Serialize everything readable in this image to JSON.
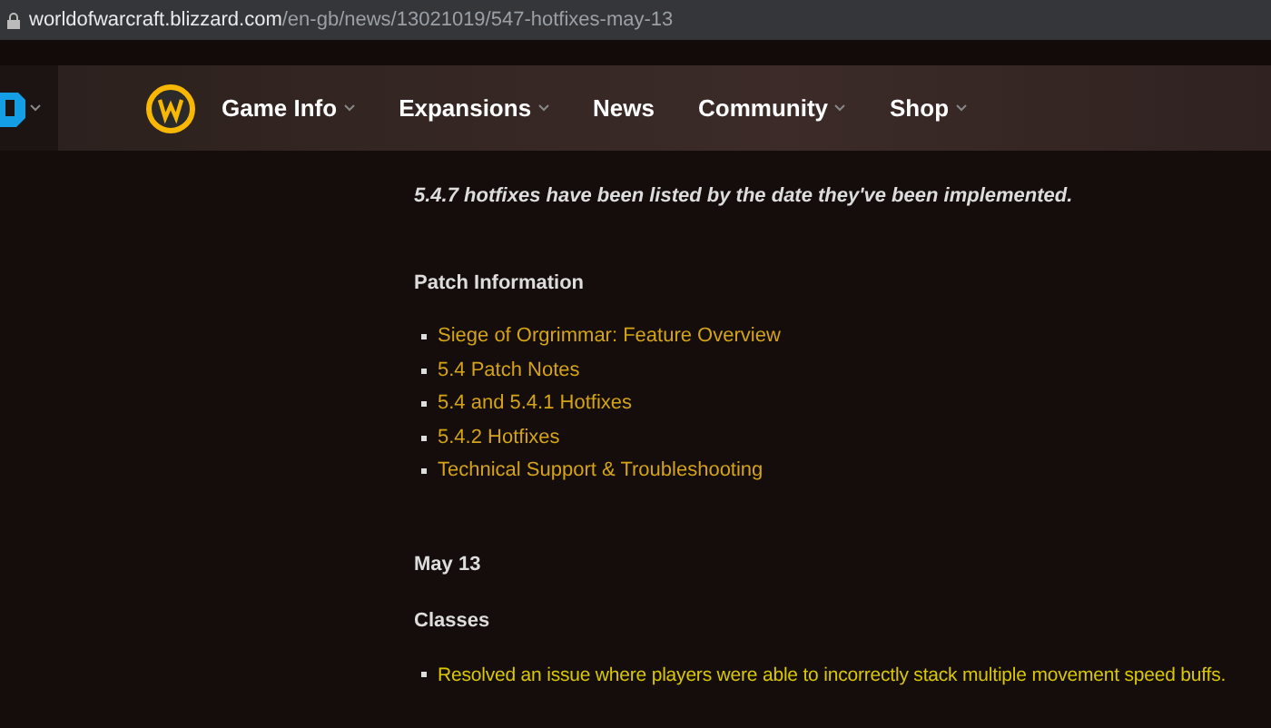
{
  "address_bar": {
    "host": "worldofwarcraft.blizzard.com",
    "path": "/en-gb/news/13021019/547-hotfixes-may-13"
  },
  "nav": {
    "items": [
      {
        "label": "Game Info",
        "dropdown": true
      },
      {
        "label": "Expansions",
        "dropdown": true
      },
      {
        "label": "News",
        "dropdown": false
      },
      {
        "label": "Community",
        "dropdown": true
      },
      {
        "label": "Shop",
        "dropdown": true
      }
    ]
  },
  "article": {
    "intro": "5.4.7 hotfixes have been listed by the date they've been implemented.",
    "patch_heading": "Patch Information",
    "patch_links": [
      "Siege of Orgrimmar: Feature Overview",
      "5.4 Patch Notes",
      "5.4 and 5.4.1 Hotfixes",
      "5.4.2 Hotfixes",
      "Technical Support & Troubleshooting"
    ],
    "date": "May 13",
    "section_heading": "Classes",
    "fixes": [
      "Resolved an issue where players were able to incorrectly stack multiple movement speed buffs."
    ]
  }
}
